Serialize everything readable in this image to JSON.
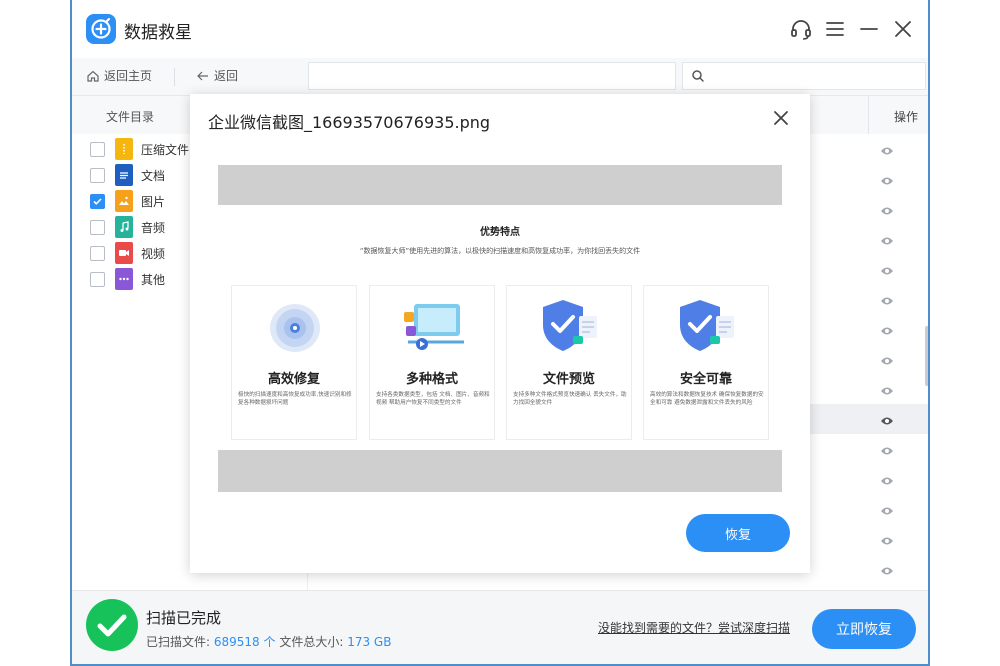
{
  "app": {
    "title": "数据救星"
  },
  "toolbar": {
    "home_label": "返回主页",
    "back_label": "返回"
  },
  "sidebar": {
    "header": "文件目录",
    "categories": [
      {
        "label": "压缩文件",
        "checked": false,
        "color": "#f5b70f",
        "icon": "zip-icon"
      },
      {
        "label": "文档",
        "checked": false,
        "color": "#1f5fbf",
        "icon": "document-icon"
      },
      {
        "label": "图片",
        "checked": true,
        "color": "#f5a11a",
        "icon": "image-icon"
      },
      {
        "label": "音频",
        "checked": false,
        "color": "#27b39a",
        "icon": "music-icon"
      },
      {
        "label": "视频",
        "checked": false,
        "color": "#e94a4a",
        "icon": "video-icon"
      },
      {
        "label": "其他",
        "checked": false,
        "color": "#8a57d6",
        "icon": "more-icon"
      }
    ]
  },
  "table": {
    "op_header": "操作"
  },
  "modal": {
    "title": "企业微信截图_16693570676935.png",
    "recover_label": "恢复",
    "preview": {
      "heading": "优势特点",
      "subheading": "“数据恢复大师”使用先进的算法，以极快的扫描速度和高恢复成功率，为你找回丢失的文件",
      "cards": [
        {
          "title": "高效修复",
          "desc": "极快的扫描速度和高恢复成功率,快速识别和修复各种数据损坏问题"
        },
        {
          "title": "多种格式",
          "desc": "支持各类数据类型，包括 文档、图片、音频和视频 帮助用户恢复不同类型的文件"
        },
        {
          "title": "文件预览",
          "desc": "支持多种文件格式预览快速确认 丢失文件，助力找回全貌文件"
        },
        {
          "title": "安全可靠",
          "desc": "高效的算法和数据恢复技术 确保恢复数据的安全和可靠 避免数据泄露和文件丢失的风险"
        }
      ]
    }
  },
  "status": {
    "title": "扫描已完成",
    "scanned_label": "已扫描文件:",
    "scanned_count": "689518 个",
    "size_label": "文件总大小:",
    "size_value": "173 GB",
    "deep_scan_link": "没能找到需要的文件？尝试深度扫描",
    "recover_now_label": "立即恢复"
  },
  "colors": {
    "accent": "#2b8ff5",
    "success": "#18c25b"
  }
}
